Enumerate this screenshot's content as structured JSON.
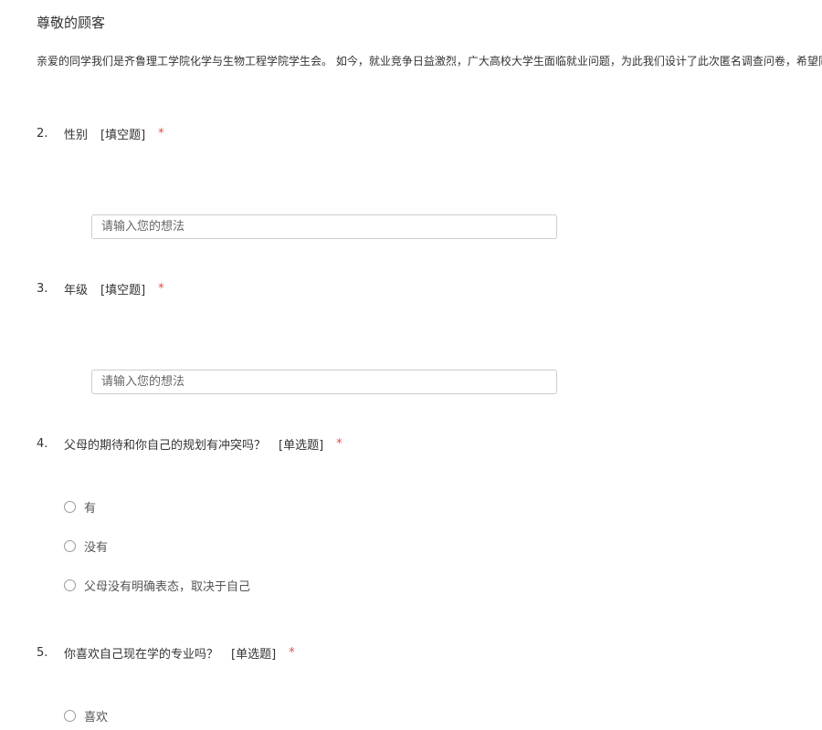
{
  "header": {
    "greeting": "尊敬的顾客",
    "intro": "亲爱的同学我们是齐鲁理工学院化学与生物工程学院学生会。 如今，就业竞争日益激烈，广大高校大学生面临就业问题，为此我们设计了此次匿名调查问卷，希望同"
  },
  "questions": [
    {
      "number": "2.",
      "title": "性别",
      "type": "[填空题]",
      "required": "*",
      "placeholder": "请输入您的想法"
    },
    {
      "number": "3.",
      "title": "年级",
      "type": "[填空题]",
      "required": "*",
      "placeholder": "请输入您的想法"
    },
    {
      "number": "4.",
      "title": "父母的期待和你自己的规划有冲突吗？",
      "type": "[单选题]",
      "required": "*",
      "options": [
        "有",
        "没有",
        "父母没有明确表态，取决于自己"
      ]
    },
    {
      "number": "5.",
      "title": "你喜欢自己现在学的专业吗？",
      "type": "[单选题]",
      "required": "*",
      "options": [
        "喜欢"
      ]
    }
  ],
  "colors": {
    "required": "#e74c3c",
    "text": "#333333",
    "border": "#cccccc"
  }
}
